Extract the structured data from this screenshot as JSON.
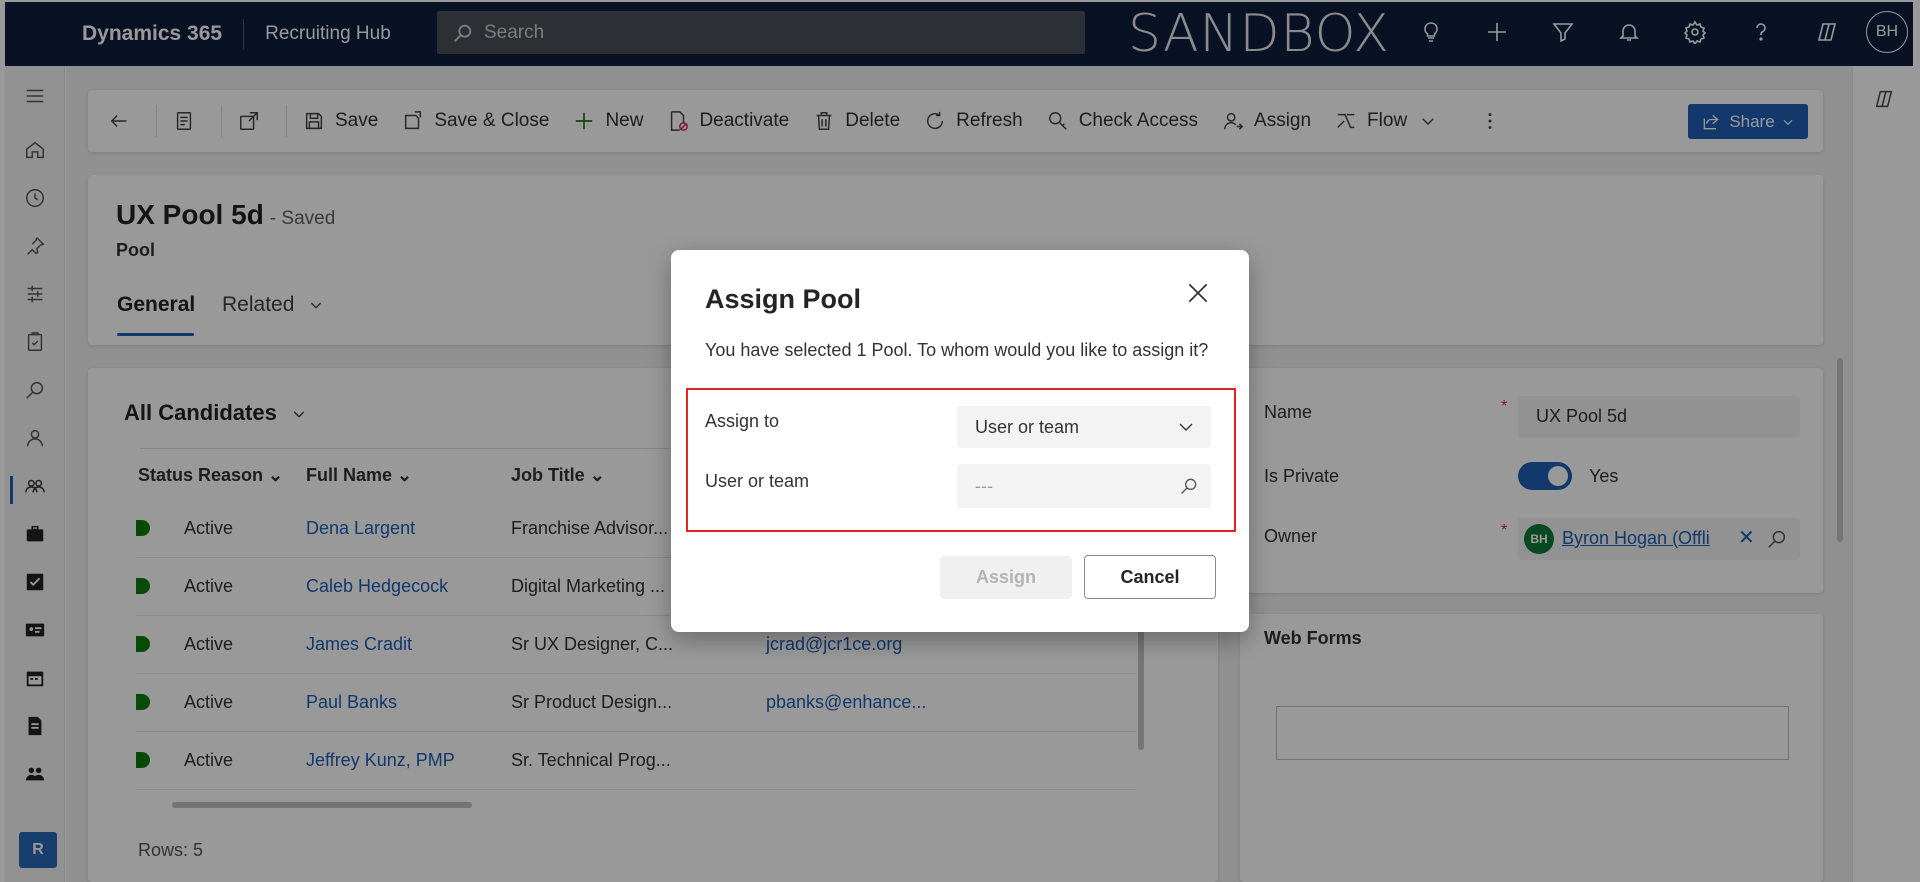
{
  "topbar": {
    "brand": "Dynamics 365",
    "app_name": "Recruiting Hub",
    "search_placeholder": "Search",
    "environment_label": "SANDBOX",
    "icons": [
      "lightbulb-icon",
      "plus-icon",
      "filter-icon",
      "bell-icon",
      "gear-icon",
      "help-icon",
      "copilot-icon"
    ],
    "user_initials": "BH"
  },
  "leftnav": {
    "icons": [
      "hamburger-icon",
      "home-icon",
      "recent-icon",
      "pin-icon",
      "hub-icon",
      "clipboard-icon",
      "search-icon",
      "person-icon",
      "people-icon",
      "briefcase-icon",
      "checkbox-icon",
      "contact-card-icon",
      "calendar-icon",
      "document-icon",
      "group-icon"
    ],
    "area_letter": "R"
  },
  "commandbar": {
    "save": "Save",
    "save_close": "Save & Close",
    "new": "New",
    "deactivate": "Deactivate",
    "delete": "Delete",
    "refresh": "Refresh",
    "check_access": "Check Access",
    "assign": "Assign",
    "flow": "Flow",
    "share": "Share"
  },
  "record": {
    "title": "UX Pool 5d",
    "saved_status": "- Saved",
    "entity": "Pool",
    "tab_general": "General",
    "tab_related": "Related"
  },
  "grid": {
    "view_name": "All Candidates",
    "columns": [
      "Status Reason",
      "Full Name",
      "Job Title"
    ],
    "rows": [
      {
        "status": "Active",
        "name": "Dena Largent",
        "job": "Franchise Advisor...",
        "email": ""
      },
      {
        "status": "Active",
        "name": "Caleb Hedgecock",
        "job": "Digital Marketing ...",
        "email": ""
      },
      {
        "status": "Active",
        "name": "James Cradit",
        "job": "Sr UX Designer, C...",
        "email": "jcrad@jcr1ce.org"
      },
      {
        "status": "Active",
        "name": "Paul Banks",
        "job": "Sr Product Design...",
        "email": "pbanks@enhance..."
      },
      {
        "status": "Active",
        "name": "Jeffrey Kunz, PMP",
        "job": "Sr. Technical Prog...",
        "email": ""
      }
    ],
    "rows_count": "Rows: 5"
  },
  "sidepanel": {
    "name_label": "Name",
    "name_value": "UX Pool 5d",
    "private_label": "Is Private",
    "private_value": "Yes",
    "owner_label": "Owner",
    "owner_initials": "BH",
    "owner_value": "Byron Hogan (Offli",
    "required_mark": "*",
    "webforms_title": "Web Forms"
  },
  "dialog": {
    "title": "Assign Pool",
    "message": "You have selected 1 Pool. To whom would you like to assign it?",
    "assign_to_label": "Assign to",
    "assign_to_value": "User or team",
    "user_team_label": "User or team",
    "user_team_placeholder": "---",
    "assign_button": "Assign",
    "cancel_button": "Cancel"
  }
}
